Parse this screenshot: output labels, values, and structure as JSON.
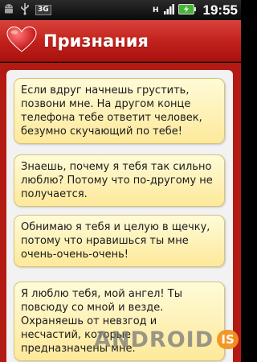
{
  "status_bar": {
    "network": "3G",
    "hd_badge": "H",
    "time": "19:55",
    "icons": [
      "android-icon",
      "usb-icon",
      "signal-3g-icon",
      "hd-icon",
      "signal-bars-icon",
      "battery-charging-icon"
    ]
  },
  "app": {
    "title": "Признания",
    "logo_icon": "heart-icon",
    "accent_color": "#c0201a"
  },
  "quotes": [
    "Если вдруг начнешь грустить, позвони мне. На другом конце телефона тебе ответит человек, безумно скучающий по тебе!",
    "Знаешь, почему я тебя так сильно люблю? Потому что по-другому не получается.",
    "Обнимаю я тебя и целую в щечку, потому что нравишься ты мне очень-очень-очень!",
    "Я люблю тебя, мой ангел! Ты повсюду со мной и везде. Охраняешь от невзгод и несчастий, которые предназначены мне."
  ],
  "watermark": {
    "text": "ANDROID",
    "badge": "IS"
  }
}
